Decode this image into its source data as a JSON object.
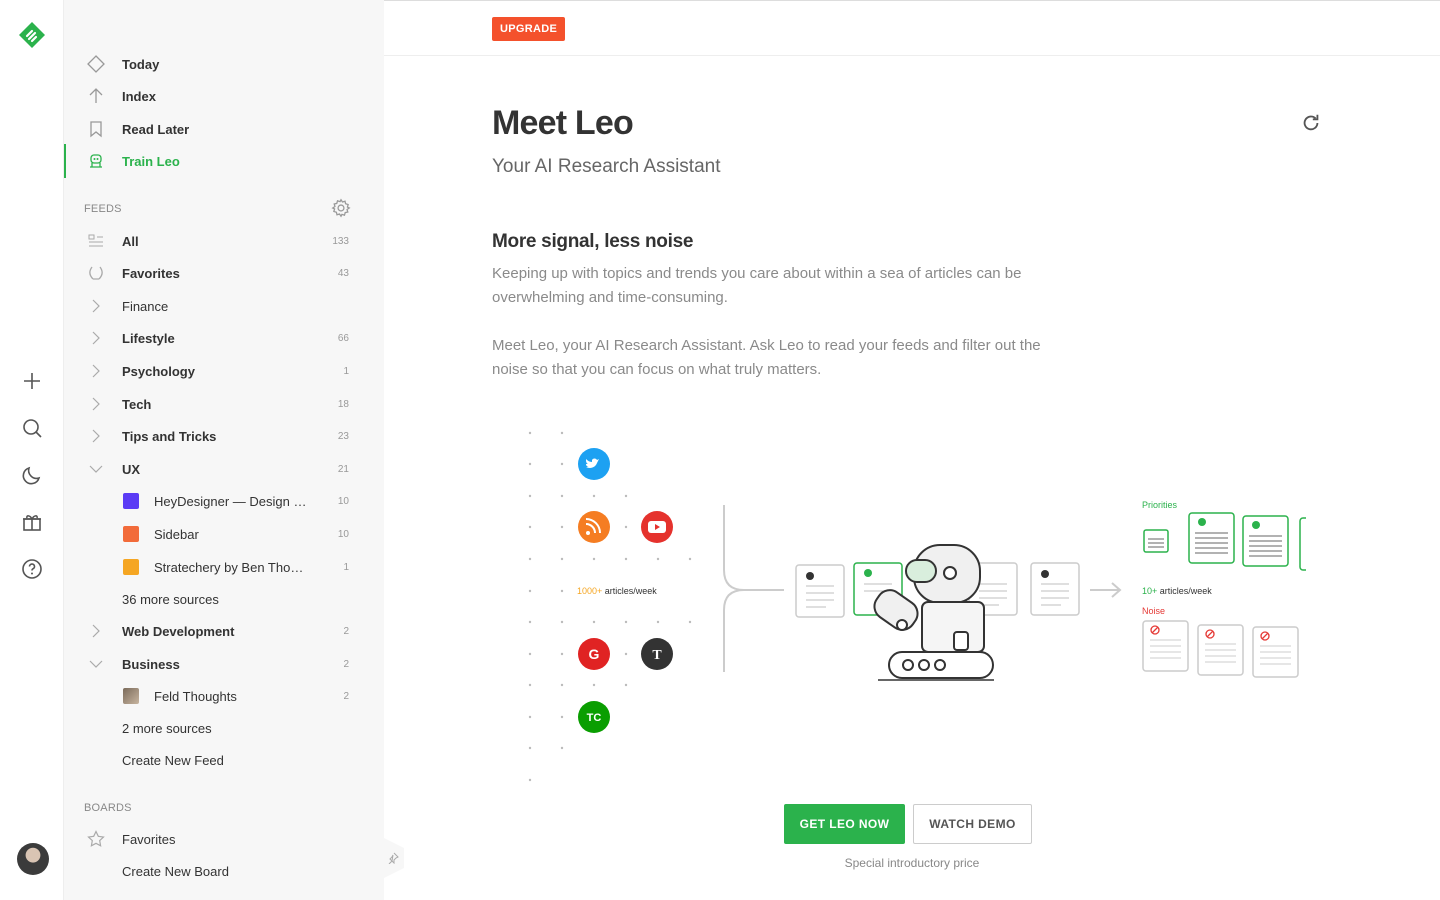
{
  "nav": [
    {
      "label": "Today",
      "icon": "today-icon"
    },
    {
      "label": "Index",
      "icon": "arrow-up-icon"
    },
    {
      "label": "Read Later",
      "icon": "bookmark-icon"
    },
    {
      "label": "Train Leo",
      "icon": "leo-robot-icon",
      "active": true
    }
  ],
  "feeds": {
    "section_label": "FEEDS",
    "rows": [
      {
        "label": "All",
        "count": "133"
      },
      {
        "label": "Favorites",
        "count": "43"
      },
      {
        "label": "Finance",
        "count": ""
      },
      {
        "label": "Lifestyle",
        "count": "66"
      },
      {
        "label": "Psychology",
        "count": "1"
      },
      {
        "label": "Tech",
        "count": "18"
      },
      {
        "label": "Tips and Tricks",
        "count": "23"
      },
      {
        "label": "UX",
        "count": "21"
      },
      {
        "label": "HeyDesigner — Design …",
        "count": "10"
      },
      {
        "label": "Sidebar",
        "count": "10"
      },
      {
        "label": "Stratechery by Ben Tho…",
        "count": "1"
      },
      {
        "label": "36 more sources",
        "count": ""
      },
      {
        "label": "Web Development",
        "count": "2"
      },
      {
        "label": "Business",
        "count": "2"
      },
      {
        "label": "Feld Thoughts",
        "count": "2"
      },
      {
        "label": "2 more sources",
        "count": ""
      },
      {
        "label": "Create New Feed",
        "count": ""
      }
    ]
  },
  "boards": {
    "section_label": "BOARDS",
    "favorites": "Favorites",
    "create": "Create New Board"
  },
  "header": {
    "upgrade": "UPGRADE"
  },
  "main": {
    "title": "Meet Leo",
    "subtitle": "Your AI Research Assistant",
    "heading": "More signal, less noise",
    "para1": "Keeping up with topics and trends you care about within a sea of articles can be overwhelming and time-consuming.",
    "para2": "Meet Leo, your AI Research Assistant. Ask Leo to read your feeds and filter out the noise so that you can focus on what truly matters.",
    "cta_primary": "GET LEO NOW",
    "cta_secondary": "WATCH DEMO",
    "note": "Special introductory price"
  },
  "illustration": {
    "input_count": "1000+",
    "input_unit": " articles/week",
    "output_count": "10+",
    "output_unit": " articles/week",
    "priorities": "Priorities",
    "noise": "Noise",
    "sources": [
      "twitter",
      "rss",
      "youtube",
      "google",
      "nytimes",
      "techcrunch"
    ]
  },
  "colors": {
    "accent": "#2bb24c",
    "upgrade": "#f4512c",
    "noise": "#e53935"
  }
}
